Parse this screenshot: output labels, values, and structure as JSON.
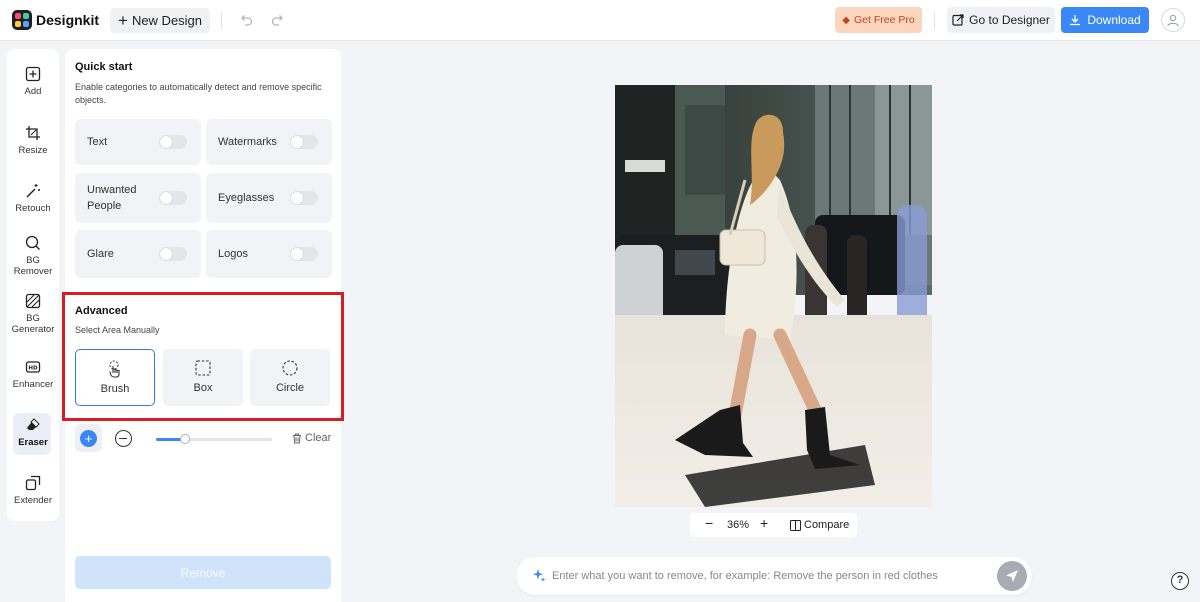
{
  "app": {
    "name": "Designkit"
  },
  "topbar": {
    "new_design_label": "New Design",
    "get_pro_label": "Get Free Pro",
    "go_designer_label": "Go to Designer",
    "download_label": "Download"
  },
  "rail": {
    "items": [
      {
        "label": "Add",
        "icon": "add-box-icon"
      },
      {
        "label": "Resize",
        "icon": "crop-icon"
      },
      {
        "label": "Retouch",
        "icon": "magic-wand-icon"
      },
      {
        "label": "BG\nRemover",
        "icon": "bg-remover-icon"
      },
      {
        "label": "BG\nGenerator",
        "icon": "bg-generator-icon"
      },
      {
        "label": "Enhancer",
        "icon": "hd-icon"
      },
      {
        "label": "Eraser",
        "icon": "eraser-icon",
        "active": true
      },
      {
        "label": "Extender",
        "icon": "extender-icon"
      }
    ]
  },
  "panel": {
    "quick_title": "Quick start",
    "quick_desc": "Enable categories to automatically detect and remove specific objects.",
    "categories": [
      {
        "label": "Text",
        "enabled": false
      },
      {
        "label": "Watermarks",
        "enabled": false
      },
      {
        "label": "Unwanted People",
        "enabled": false
      },
      {
        "label": "Eyeglasses",
        "enabled": false
      },
      {
        "label": "Glare",
        "enabled": false
      },
      {
        "label": "Logos",
        "enabled": false
      }
    ],
    "advanced_title": "Advanced",
    "advanced_desc": "Select Area Manually",
    "tools": [
      {
        "label": "Brush",
        "icon": "brush-hand-icon",
        "selected": true
      },
      {
        "label": "Box",
        "icon": "dashed-square-icon"
      },
      {
        "label": "Circle",
        "icon": "dashed-circle-icon"
      }
    ],
    "brush_size_fraction": 0.25,
    "clear_label": "Clear",
    "remove_label": "Remove"
  },
  "canvas": {
    "zoom": "36%",
    "compare_label": "Compare"
  },
  "prompt": {
    "placeholder": "Enter what you want to remove, for example: Remove the person in red clothes"
  },
  "colors": {
    "accent": "#3a88f5",
    "highlight_frame": "#d71c23",
    "pro_bg": "#fbd5bd",
    "pro_text": "#c2461b"
  }
}
